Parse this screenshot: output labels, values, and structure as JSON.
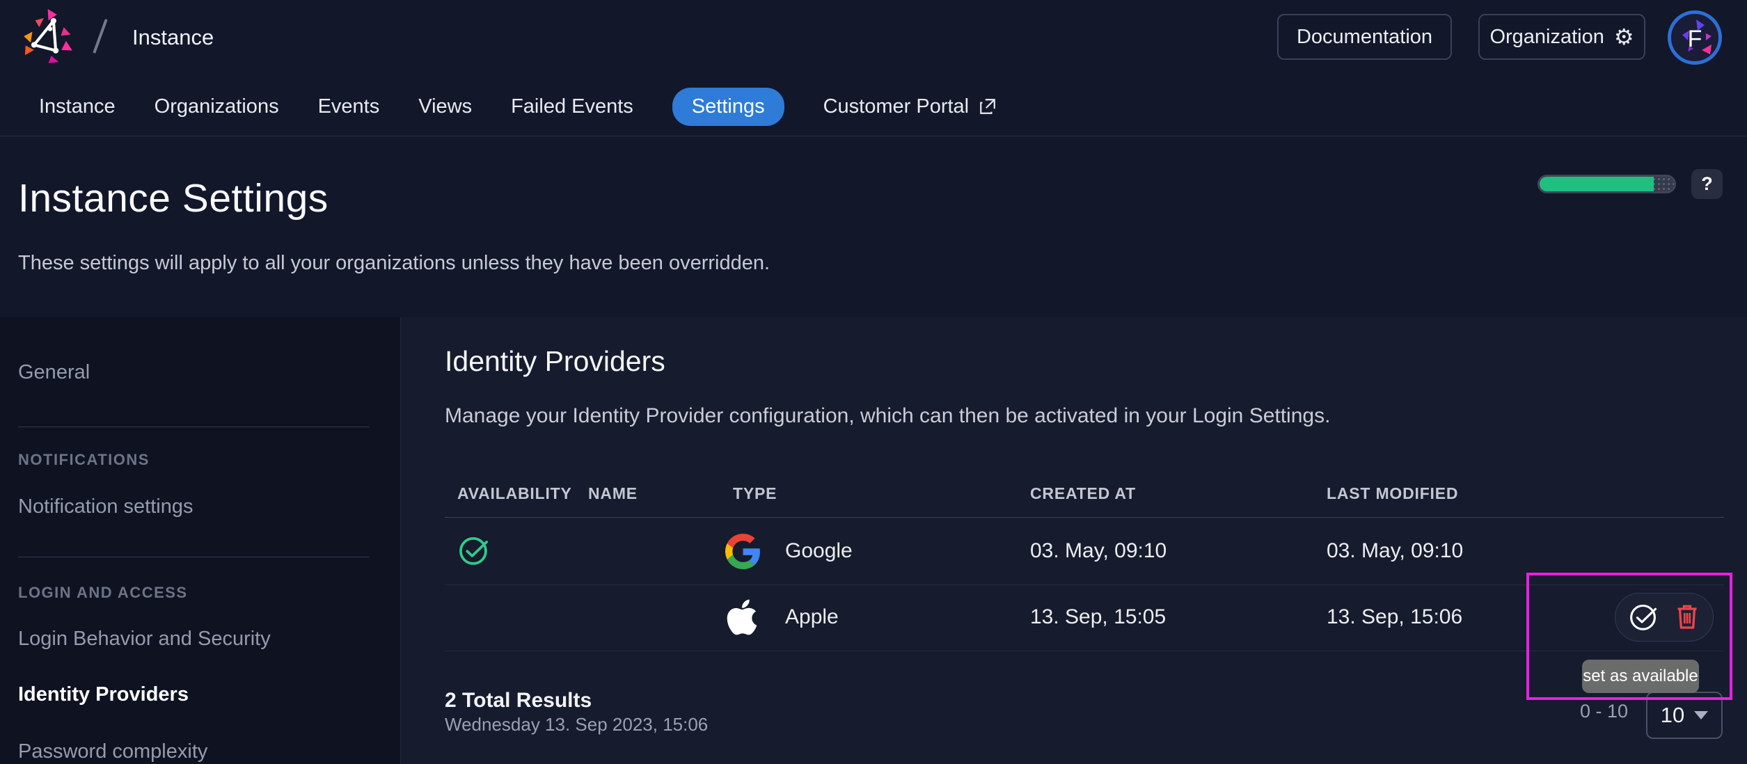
{
  "topbar": {
    "breadcrumb": "Instance",
    "documentation_button": "Documentation",
    "organization_button": "Organization",
    "avatar_initial": "F"
  },
  "icons": {
    "gear_glyph": "⚙"
  },
  "nav": {
    "tabs": [
      {
        "label": "Instance"
      },
      {
        "label": "Organizations"
      },
      {
        "label": "Events"
      },
      {
        "label": "Views"
      },
      {
        "label": "Failed Events"
      },
      {
        "label": "Settings",
        "active": true
      },
      {
        "label": "Customer Portal",
        "external": true
      }
    ],
    "quota_percent": 85,
    "help_label": "?"
  },
  "hero": {
    "title": "Instance Settings",
    "subtitle": "These settings will apply to all your organizations unless they have been overridden."
  },
  "sidebar": {
    "items": [
      {
        "label": "General"
      },
      {
        "header": "NOTIFICATIONS"
      },
      {
        "label": "Notification settings"
      },
      {
        "header": "LOGIN AND ACCESS"
      },
      {
        "label": "Login Behavior and Security"
      },
      {
        "label": "Identity Providers",
        "active": true
      },
      {
        "label": "Password complexity"
      }
    ]
  },
  "main": {
    "heading": "Identity Providers",
    "description": "Manage your Identity Provider configuration, which can then be activated in your Login Settings.",
    "table": {
      "columns": [
        "AVAILABILITY",
        "NAME",
        "TYPE",
        "CREATED AT",
        "LAST MODIFIED"
      ],
      "rows": [
        {
          "available": true,
          "name": "",
          "type": "Google",
          "type_icon": "google-logo",
          "created_at": "03. May, 09:10",
          "last_modified": "03. May, 09:10"
        },
        {
          "available": false,
          "name": "",
          "type": "Apple",
          "type_icon": "apple-logo",
          "created_at": "13. Sep, 15:05",
          "last_modified": "13. Sep, 15:06"
        }
      ],
      "footer": {
        "total": "2 Total Results",
        "timestamp": "Wednesday 13. Sep 2023, 15:06"
      },
      "pagination": {
        "range": "0 - 10",
        "page_size": "10"
      }
    },
    "row_actions": {
      "tooltip": "set as available",
      "icons": [
        "set-available-icon",
        "delete-icon"
      ]
    }
  },
  "colors": {
    "accent_blue": "#2f7bd8",
    "success_green": "#21bf7f",
    "danger_red": "#ef4449",
    "annotation_magenta": "#ea1fe4",
    "avatar_ring_blue": "#2d6fd4",
    "tooltip_gray": "#6e6e6e"
  }
}
